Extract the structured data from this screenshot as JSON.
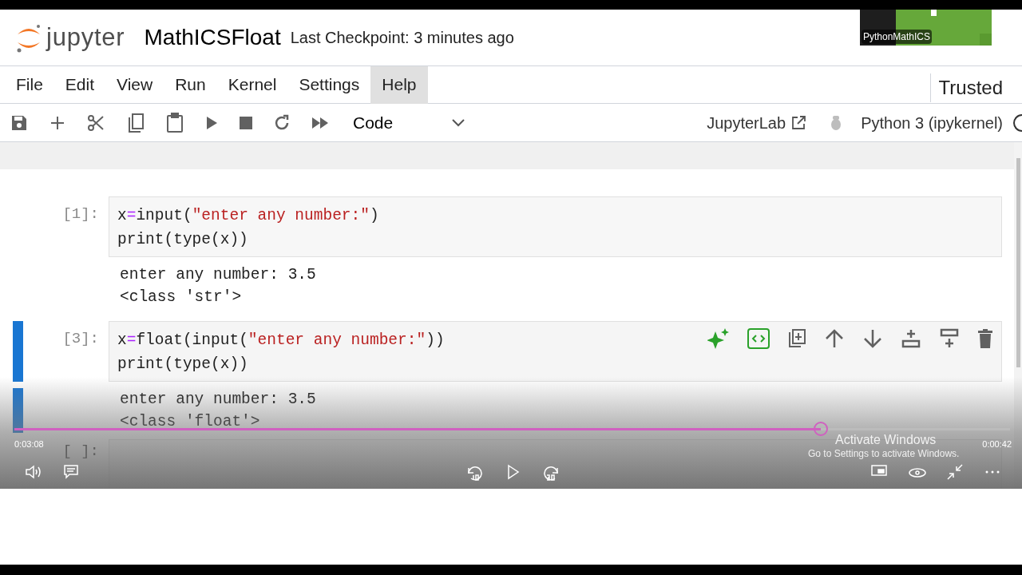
{
  "header": {
    "logo_text": "jupyter",
    "notebook_title": "MathICSFloat",
    "checkpoint": "Last Checkpoint: 3 minutes ago"
  },
  "webcam": {
    "kind": "picture",
    "label": "PythonMathICS"
  },
  "menu": [
    {
      "label": "File",
      "selected": false
    },
    {
      "label": "Edit",
      "selected": false
    },
    {
      "label": "View",
      "selected": false
    },
    {
      "label": "Run",
      "selected": false
    },
    {
      "label": "Kernel",
      "selected": false
    },
    {
      "label": "Settings",
      "selected": false
    },
    {
      "label": "Help",
      "selected": true
    }
  ],
  "trusted": "Trusted",
  "toolbar": {
    "cell_type": "Code",
    "jupyterlab": "JupyterLab",
    "kernel": "Python 3 (ipykernel)"
  },
  "cells": [
    {
      "prompt": "[1]:",
      "active": false,
      "code": [
        "x=input(\"enter any number:\")",
        "print(type(x))"
      ],
      "output": [
        "enter any number: 3.5",
        "<class 'str'>"
      ]
    },
    {
      "prompt": "[3]:",
      "active": true,
      "code": [
        "x=float(input(\"enter any number:\"))",
        "print(type(x))"
      ],
      "output": [
        "enter any number: 3.5",
        "<class 'float'>"
      ]
    },
    {
      "prompt": "[ ]:",
      "active": false
    }
  ],
  "video": {
    "level": 0.81,
    "elapsed": "0:03:08",
    "remaining": "0:00:42",
    "notice_title": "Activate Windows",
    "notice_text": "Go to Settings to activate Windows."
  }
}
